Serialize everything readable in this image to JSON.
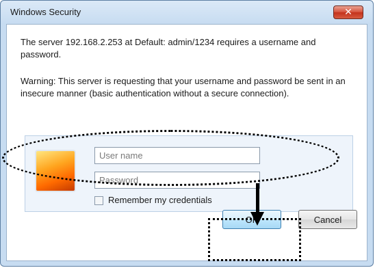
{
  "window": {
    "title": "Windows Security",
    "close_glyph": "✕"
  },
  "message": {
    "line1": "The server 192.168.2.253 at Default: admin/1234 requires a username and password.",
    "warning": "Warning: This server is requesting that your username and password be sent in an insecure manner (basic authentication without a secure connection)."
  },
  "credentials": {
    "tile_icon": "user-picture-icon",
    "username_placeholder": "User name",
    "password_placeholder": "Password",
    "remember_label": "Remember my credentials",
    "remember_checked": false
  },
  "buttons": {
    "ok_label": "OK",
    "cancel_label": "Cancel"
  },
  "annotations": {
    "color": "#000000",
    "items": [
      "credentials-ellipse",
      "down-arrow",
      "ok-highlight-box"
    ]
  },
  "colors": {
    "frame": "#c7dcf1",
    "close_button": "#c4321c",
    "default_button": "#a7d9f5"
  }
}
